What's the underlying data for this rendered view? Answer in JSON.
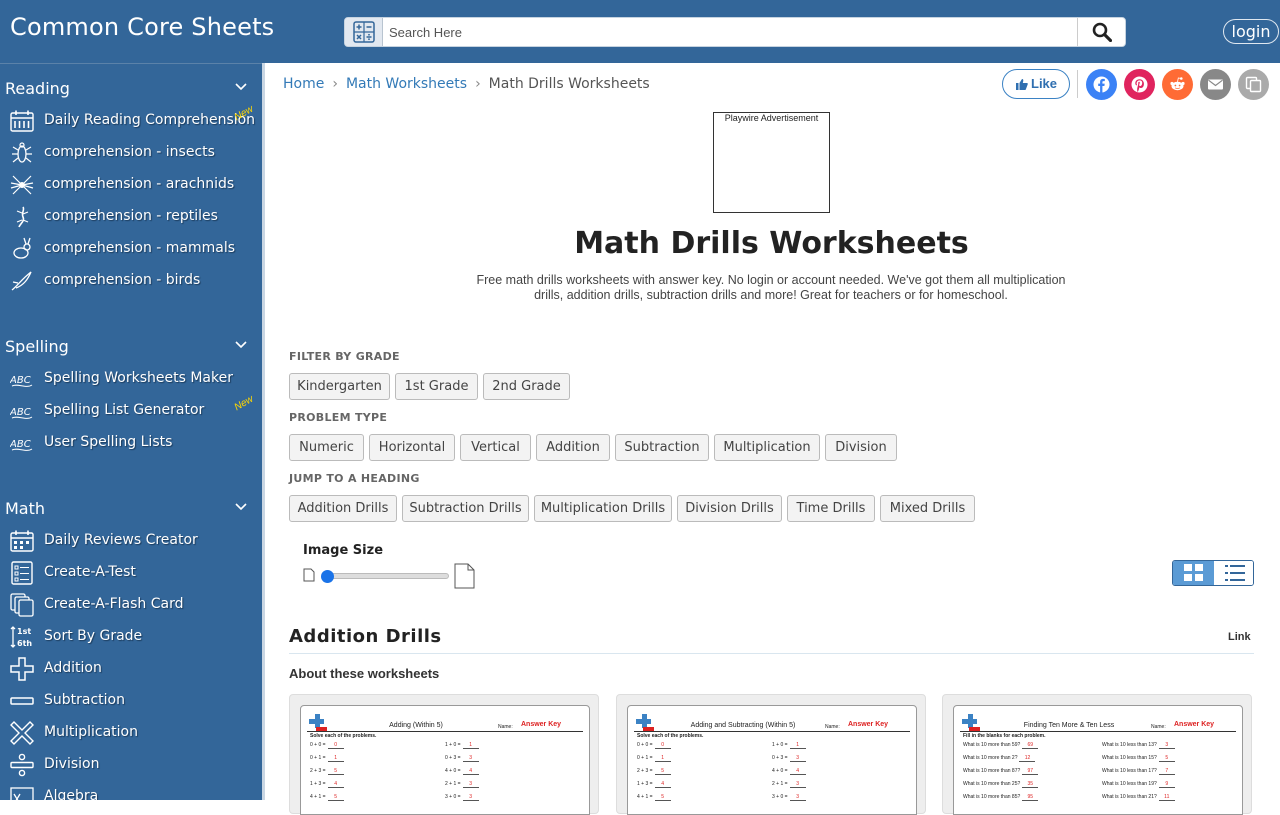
{
  "header": {
    "brand": "Common Core Sheets",
    "search_placeholder": "Search Here",
    "login_label": "login"
  },
  "sidebar": {
    "reading": {
      "title": "Reading",
      "items": [
        {
          "label": "Daily Reading Comprehension",
          "icon": "calendar-icon",
          "badge": "New"
        },
        {
          "label": "comprehension - insects",
          "icon": "insect-icon"
        },
        {
          "label": "comprehension - arachnids",
          "icon": "spider-icon"
        },
        {
          "label": "comprehension - reptiles",
          "icon": "lizard-icon"
        },
        {
          "label": "comprehension - mammals",
          "icon": "rabbit-icon"
        },
        {
          "label": "comprehension - birds",
          "icon": "bird-icon"
        }
      ]
    },
    "spelling": {
      "title": "Spelling",
      "items": [
        {
          "label": "Spelling Worksheets Maker",
          "icon": "abc-icon"
        },
        {
          "label": "Spelling List Generator",
          "icon": "abc-icon",
          "badge": "New"
        },
        {
          "label": "User Spelling Lists",
          "icon": "abc-icon"
        }
      ]
    },
    "math": {
      "title": "Math",
      "items": [
        {
          "label": "Daily Reviews Creator",
          "icon": "calendar-icon"
        },
        {
          "label": "Create-A-Test",
          "icon": "checklist-icon"
        },
        {
          "label": "Create-A-Flash Card",
          "icon": "cards-icon"
        },
        {
          "label": "Sort By Grade",
          "icon": "grade-sort-icon",
          "icon_text_top": "1st",
          "icon_text_bottom": "6th"
        },
        {
          "label": "Addition",
          "icon": "plus-icon"
        },
        {
          "label": "Subtraction",
          "icon": "minus-icon"
        },
        {
          "label": "Multiplication",
          "icon": "times-icon"
        },
        {
          "label": "Division",
          "icon": "divide-icon"
        },
        {
          "label": "Algebra",
          "icon": "algebra-icon"
        }
      ]
    }
  },
  "breadcrumb": {
    "home": "Home",
    "math": "Math Worksheets",
    "current": "Math Drills Worksheets",
    "separator": "›"
  },
  "social": {
    "like_label": "Like",
    "colors": {
      "facebook": "#3b82f6",
      "pinterest": "#e0245e",
      "reddit": "#ff6b35",
      "email": "#888888",
      "copy": "#aaaaaa"
    }
  },
  "ad": {
    "label": "Playwire Advertisement"
  },
  "page": {
    "title": "Math Drills Worksheets",
    "description": "Free math drills worksheets with answer key. No login or account needed. We've got them all multiplication drills, addition drills, subtraction drills and more! Great for teachers or for homeschool."
  },
  "filters": {
    "grade_label": "FILTER BY GRADE",
    "grades": [
      "Kindergarten",
      "1st Grade",
      "2nd Grade"
    ],
    "type_label": "PROBLEM TYPE",
    "types": [
      "Numeric",
      "Horizontal",
      "Vertical",
      "Addition",
      "Subtraction",
      "Multiplication",
      "Division"
    ],
    "jump_label": "JUMP TO A HEADING",
    "jumps": [
      "Addition Drills",
      "Subtraction Drills",
      "Multiplication Drills",
      "Division Drills",
      "Time Drills",
      "Mixed Drills"
    ]
  },
  "image_size": {
    "label": "Image Size",
    "value": 0
  },
  "section": {
    "title": "Addition Drills",
    "link_label": "Link",
    "about_label": "About these worksheets"
  },
  "cards": [
    {
      "title": "Adding (Within 5)",
      "name_label": "Name:",
      "key_label": "Answer Key",
      "instruction": "Solve each of the problems.",
      "left": [
        [
          "0 + 0 =",
          "0"
        ],
        [
          "0 + 1 =",
          "1"
        ],
        [
          "2 + 3 =",
          "5"
        ],
        [
          "1 + 3 =",
          "4"
        ],
        [
          "4 + 1 =",
          "5"
        ]
      ],
      "right": [
        [
          "1 + 0 =",
          "1"
        ],
        [
          "0 + 3 =",
          "3"
        ],
        [
          "4 + 0 =",
          "4"
        ],
        [
          "2 + 1 =",
          "3"
        ],
        [
          "3 + 0 =",
          "3"
        ]
      ]
    },
    {
      "title": "Adding and Subtracting (Within 5)",
      "name_label": "Name:",
      "key_label": "Answer Key",
      "instruction": "Solve each of the problems.",
      "left": [
        [
          "0 + 0 =",
          "0"
        ],
        [
          "0 + 1 =",
          "1"
        ],
        [
          "2 + 3 =",
          "5"
        ],
        [
          "1 + 3 =",
          "4"
        ],
        [
          "4 + 1 =",
          "5"
        ]
      ],
      "right": [
        [
          "1 + 0 =",
          "1"
        ],
        [
          "0 + 3 =",
          "3"
        ],
        [
          "4 + 0 =",
          "4"
        ],
        [
          "2 + 1 =",
          "3"
        ],
        [
          "3 + 0 =",
          "3"
        ]
      ]
    },
    {
      "title": "Finding Ten More & Ten Less",
      "name_label": "Name:",
      "key_label": "Answer Key",
      "instruction": "Fill in the blanks for each problem.",
      "left": [
        [
          "What is 10 more than 59?",
          "69"
        ],
        [
          "What is 10 more than 2?",
          "12"
        ],
        [
          "What is 10 more than 87?",
          "97"
        ],
        [
          "What is 10 more than 25?",
          "35"
        ],
        [
          "What is 10 more than 85?",
          "95"
        ]
      ],
      "right": [
        [
          "What is 10 less than 13?",
          "3"
        ],
        [
          "What is 10 less than 15?",
          "5"
        ],
        [
          "What is 10 less than 17?",
          "7"
        ],
        [
          "What is 10 less than 19?",
          "9"
        ],
        [
          "What is 10 less than 21?",
          "11"
        ]
      ]
    }
  ]
}
